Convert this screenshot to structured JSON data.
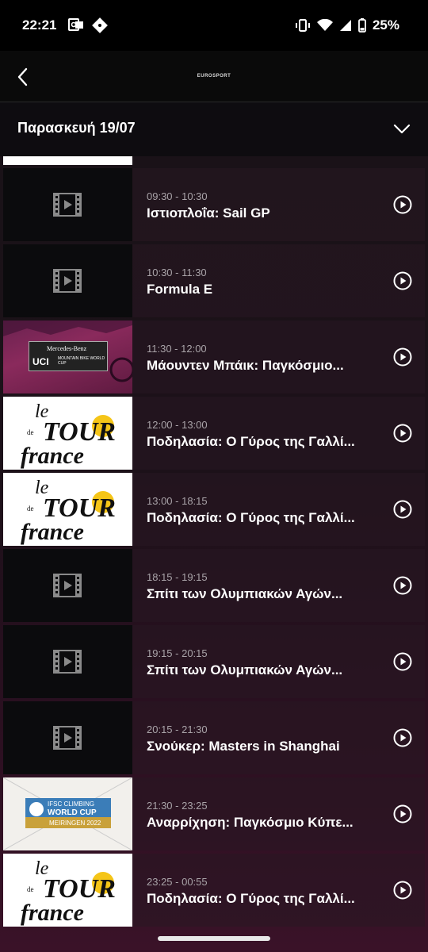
{
  "status_bar": {
    "time": "22:21",
    "battery": "25%"
  },
  "app_bar": {
    "logo": "EUROSPORT"
  },
  "date_selector": {
    "label": "Παρασκευή 19/07"
  },
  "tour_logo": {
    "text": "le Tour de France"
  },
  "schedule": [
    {
      "time": "09:30 - 10:30",
      "title": "Ιστιοπλοΐα: Sail GP",
      "thumb": "film-placeholder"
    },
    {
      "time": "10:30 - 11:30",
      "title": "Formula E",
      "thumb": "film-placeholder"
    },
    {
      "time": "11:30 - 12:00",
      "title": "Μάουντεν Μπάικ: Παγκόσμιο...",
      "thumb": "mtb-world-cup",
      "thumb_text": {
        "l1": "Mercedes-Benz",
        "l2": "UCI",
        "l3": "MOUNTAIN BIKE WORLD CUP"
      }
    },
    {
      "time": "12:00 - 13:00",
      "title": "Ποδηλασία: Ο Γύρος της Γαλλί...",
      "thumb": "tour-de-france"
    },
    {
      "time": "13:00 - 18:15",
      "title": "Ποδηλασία: Ο Γύρος της Γαλλί...",
      "thumb": "tour-de-france"
    },
    {
      "time": "18:15 - 19:15",
      "title": "Σπίτι των Ολυμπιακών Αγών...",
      "thumb": "film-placeholder"
    },
    {
      "time": "19:15 - 20:15",
      "title": "Σπίτι των Ολυμπιακών Αγών...",
      "thumb": "film-placeholder"
    },
    {
      "time": "20:15 - 21:30",
      "title": "Σνούκερ: Masters in Shanghai",
      "thumb": "film-placeholder"
    },
    {
      "time": "21:30 - 23:25",
      "title": "Αναρρίχηση: Παγκόσμιο Κύπε...",
      "thumb": "ifsc-climbing",
      "thumb_text": {
        "l1": "IFSC CLIMBING",
        "l2": "WORLD CUP",
        "l3": "MEIRINGEN 2022"
      }
    },
    {
      "time": "23:25 - 00:55",
      "title": "Ποδηλασία: Ο Γύρος της Γαλλί...",
      "thumb": "tour-de-france"
    }
  ]
}
